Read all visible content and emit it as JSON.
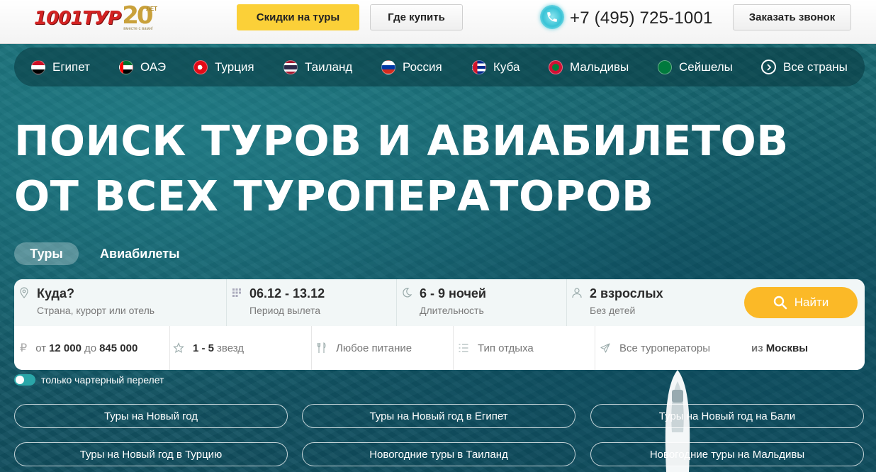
{
  "header": {
    "logo_text": "1001ТУР",
    "logo_years": "20",
    "logo_years_label": "ЛЕТ",
    "logo_tagline": "вместе с вами!",
    "deals_label": "Скидки на туры",
    "where_label": "Где купить",
    "phone": "+7 (495) 725-1001",
    "callback_label": "Заказать звонок"
  },
  "countries": [
    {
      "label": "Египет"
    },
    {
      "label": "ОАЭ"
    },
    {
      "label": "Турция"
    },
    {
      "label": "Таиланд"
    },
    {
      "label": "Россия"
    },
    {
      "label": "Куба"
    },
    {
      "label": "Мальдивы"
    },
    {
      "label": "Сейшелы"
    },
    {
      "label": "Все страны"
    }
  ],
  "hero": {
    "line1": "ПОИСК ТУРОВ И АВИАБИЛЕТОВ",
    "line2": "ОТ ВСЕХ ТУРОПЕРАТОРОВ"
  },
  "tabs": {
    "tours": "Туры",
    "avia": "Авиабилеты"
  },
  "search": {
    "where_label": "Куда?",
    "where_hint": "Страна, курорт или отель",
    "dates_value": "06.12 - 13.12",
    "dates_label": "Период вылета",
    "nights_value": "6 - 9 ночей",
    "nights_label": "Длительность",
    "guests_value": "2 взрослых",
    "guests_label": "Без детей",
    "button_label": "Найти"
  },
  "filters": {
    "price_from_prefix": "от",
    "price_from": "12 000",
    "price_to_prefix": "до",
    "price_to": "845 000",
    "stars": "1 - 5",
    "stars_suffix": "звезд",
    "meals": "Любое питание",
    "rest_type": "Тип отдыха",
    "operators": "Все туроператоры",
    "from_prefix": "из",
    "from_city": "Москвы"
  },
  "charter": {
    "label": "только чартерный перелет"
  },
  "quick_links": [
    {
      "label": "Туры на Новый год"
    },
    {
      "label": "Туры на Новый год в Египет"
    },
    {
      "label": "Туры на Новый год на Бали"
    },
    {
      "label": "Туры на Новый год в Турцию"
    },
    {
      "label": "Новогодние туры в Таиланд"
    },
    {
      "label": "Новогодние туры на Мальдивы"
    }
  ],
  "colors": {
    "accent_yellow": "#fbd038",
    "search_button": "#fbb927",
    "logo_red": "#d32323",
    "toggle_teal": "#2aa6a8"
  }
}
